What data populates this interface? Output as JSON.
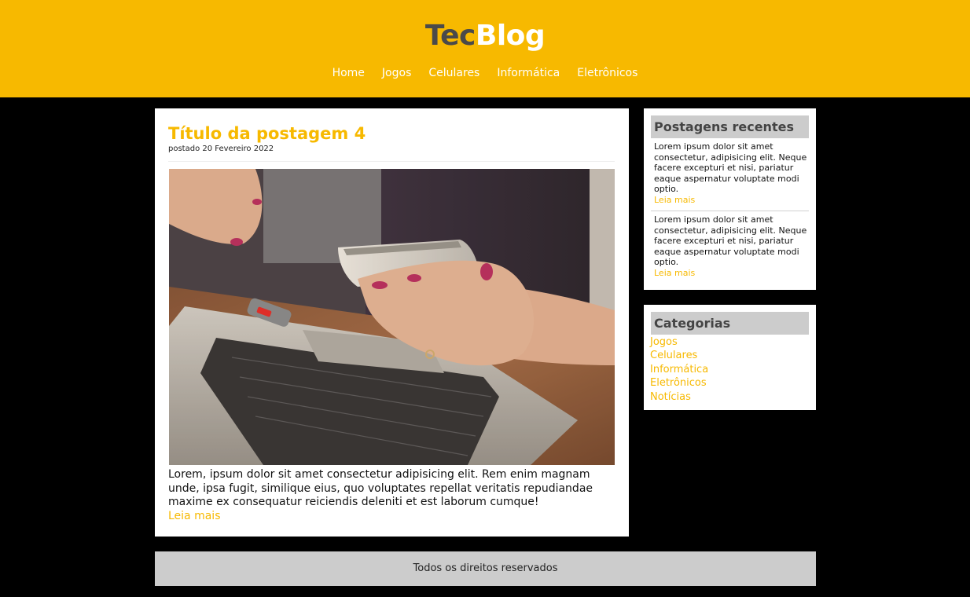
{
  "header": {
    "logo_part1": "Tec",
    "logo_part2": "Blog",
    "nav": [
      "Home",
      "Jogos",
      "Celulares",
      "Informática",
      "Eletrônicos"
    ]
  },
  "post": {
    "title": "Título da postagem 4",
    "date": "postado 20 Fevereiro 2022",
    "body": "Lorem, ipsum dolor sit amet consectetur adipisicing elit. Rem enim magnam unde, ipsa fugit, similique eius, quo voluptates repellat veritatis repudiandae maxime ex consequatur reiciendis deleniti et est laborum cumque!",
    "read_more": "Leia mais"
  },
  "recent": {
    "title": "Postagens recentes",
    "items": [
      {
        "text": "Lorem ipsum dolor sit amet consectetur, adipisicing elit. Neque facere excepturi et nisi, pariatur eaque aspernatur voluptate modi optio.",
        "read_more": "Leia mais"
      },
      {
        "text": "Lorem ipsum dolor sit amet consectetur, adipisicing elit. Neque facere excepturi et nisi, pariatur eaque aspernatur voluptate modi optio.",
        "read_more": "Leia mais"
      }
    ]
  },
  "categories": {
    "title": "Categorias",
    "items": [
      "Jogos",
      "Celulares",
      "Informática",
      "Eletrônicos",
      "Notícias"
    ]
  },
  "footer": {
    "text": "Todos os direitos reservados"
  },
  "colors": {
    "accent": "#f7b900",
    "background": "#000000",
    "panel": "#ffffff",
    "widget_header": "#cccccc"
  }
}
